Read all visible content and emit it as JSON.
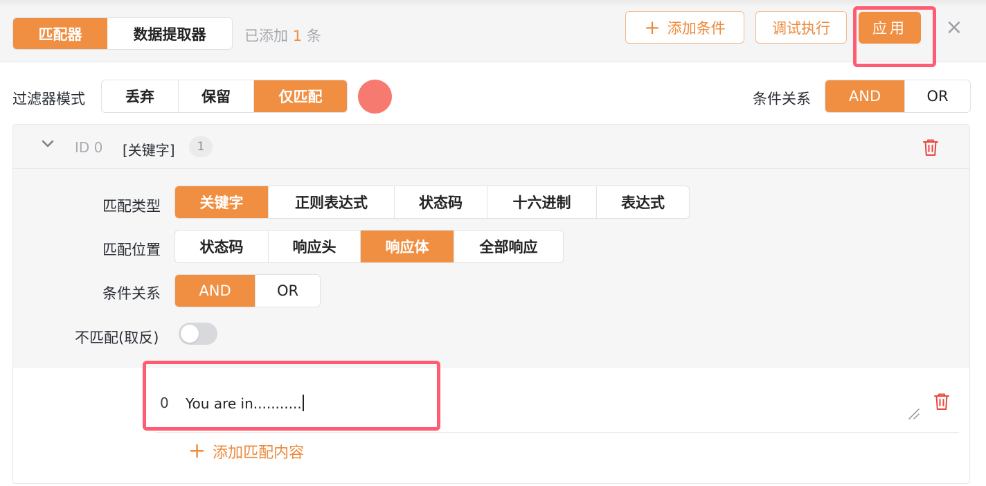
{
  "header": {
    "tabs": [
      {
        "label": "匹配器",
        "active": true
      },
      {
        "label": "数据提取器",
        "active": false
      }
    ],
    "added_prefix": "已添加",
    "added_count": "1",
    "added_suffix": "条",
    "add_condition_label": "添加条件",
    "debug_label": "调试执行",
    "apply_label": "应用",
    "close_icon": "×"
  },
  "filter": {
    "mode_label": "过滤器模式",
    "modes": [
      "丢弃",
      "保留",
      "仅匹配"
    ],
    "active_mode": "仅匹配",
    "relation_label": "条件关系",
    "relations": [
      "AND",
      "OR"
    ],
    "active_relation": "AND",
    "color_dot": "#f67a6f"
  },
  "rule": {
    "id_label": "ID 0",
    "type_tag": "[关键字]",
    "count": "1",
    "match_type_label": "匹配类型",
    "match_types": [
      "关键字",
      "正则表达式",
      "状态码",
      "十六进制",
      "表达式"
    ],
    "active_match_type": "关键字",
    "match_pos_label": "匹配位置",
    "match_positions": [
      "状态码",
      "响应头",
      "响应体",
      "全部响应"
    ],
    "active_match_position": "响应体",
    "relation_label": "条件关系",
    "relations": [
      "AND",
      "OR"
    ],
    "active_relation": "AND",
    "negate_label": "不匹配(取反)",
    "negate_on": false,
    "contents": [
      {
        "index": "0",
        "value": "You are in..........."
      }
    ],
    "add_content_label": "添加匹配内容"
  },
  "colors": {
    "accent": "#f08f42",
    "highlight": "#fd5c73",
    "danger": "#e9473f"
  }
}
